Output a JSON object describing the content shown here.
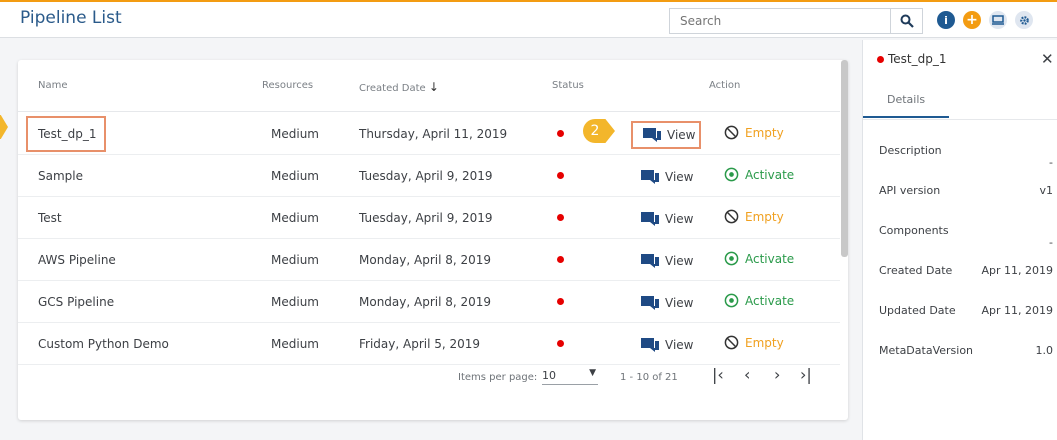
{
  "header": {
    "title": "Pipeline List",
    "search_placeholder": "Search"
  },
  "table": {
    "columns": [
      "Name",
      "Resources",
      "Created Date",
      "Status",
      "Action"
    ],
    "sort_indicator": "↓",
    "view_label": "View",
    "rows": [
      {
        "name": "Test_dp_1",
        "resources": "Medium",
        "created": "Thursday, April 11, 2019",
        "action": "Empty"
      },
      {
        "name": "Sample",
        "resources": "Medium",
        "created": "Tuesday, April 9, 2019",
        "action": "Activate"
      },
      {
        "name": "Test",
        "resources": "Medium",
        "created": "Tuesday, April 9, 2019",
        "action": "Empty"
      },
      {
        "name": "AWS Pipeline",
        "resources": "Medium",
        "created": "Monday, April 8, 2019",
        "action": "Activate"
      },
      {
        "name": "GCS Pipeline",
        "resources": "Medium",
        "created": "Monday, April 8, 2019",
        "action": "Activate"
      },
      {
        "name": "Custom Python Demo",
        "resources": "Medium",
        "created": "Friday, April 5, 2019",
        "action": "Empty"
      }
    ]
  },
  "pagination": {
    "items_per_page_label": "Items per page:",
    "page_size": "10",
    "range": "1 - 10 of 21"
  },
  "callouts": {
    "step2": "2"
  },
  "details_panel": {
    "title": "Test_dp_1",
    "tab": "Details",
    "fields": [
      {
        "label": "Description",
        "value": "-"
      },
      {
        "label": "API version",
        "value": "v1"
      },
      {
        "label": "Components",
        "value": "-"
      },
      {
        "label": "Created Date",
        "value": "Apr 11, 2019"
      },
      {
        "label": "Updated Date",
        "value": "Apr 11, 2019"
      },
      {
        "label": "MetaDataVersion",
        "value": "1.0"
      }
    ]
  },
  "colors": {
    "accent": "#f39c12",
    "status_inactive": "#e60000",
    "empty": "#f0a020",
    "activate": "#2a9a4a",
    "highlight": "#e8906a"
  }
}
